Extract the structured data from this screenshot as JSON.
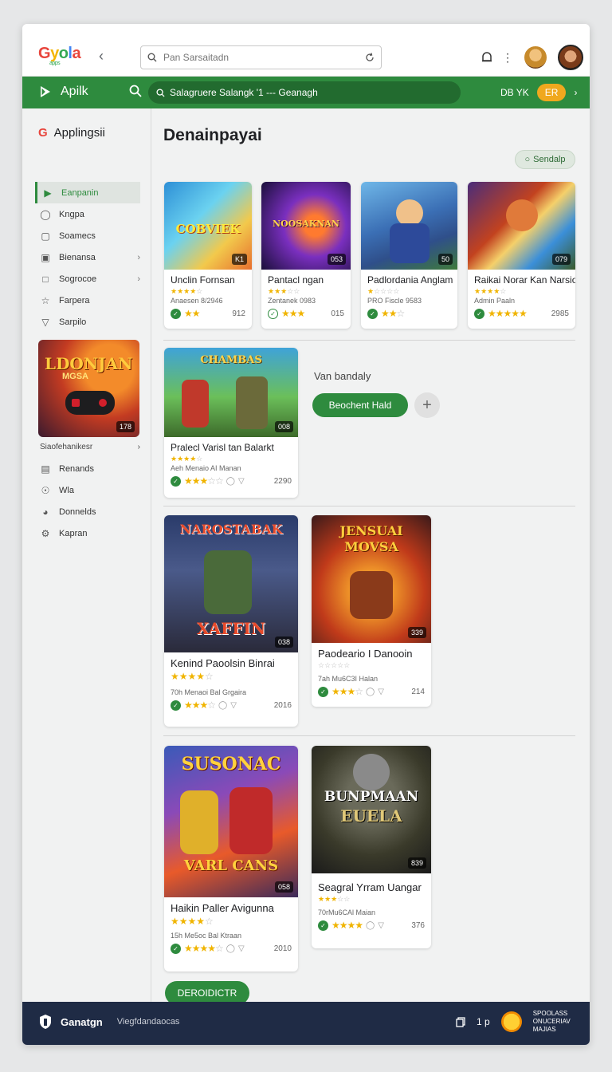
{
  "topbar": {
    "logo": "Gyola",
    "logo_sub": "apps",
    "search_placeholder": "Pan Sarsaitadn"
  },
  "greenbar": {
    "title": "Apilk",
    "search_text": "Salagruere Salangk '1 --- Geanagh",
    "lang": "DB YK",
    "badge": "ER"
  },
  "sidebar": {
    "title": "Applingsii",
    "items": [
      {
        "label": "Eanpanin",
        "icon": "play-icon"
      },
      {
        "label": "Kngpa",
        "icon": "drop-icon"
      },
      {
        "label": "Soamecs",
        "icon": "bag-icon"
      },
      {
        "label": "Bienansa",
        "icon": "book-icon"
      },
      {
        "label": "Sogrocoe",
        "icon": "square-icon"
      },
      {
        "label": "Farpera",
        "icon": "star-icon"
      },
      {
        "label": "Sarpilo",
        "icon": "shield-icon"
      }
    ],
    "promo": {
      "title": "LDONJAN",
      "subtitle": "MGSA",
      "badge": "178"
    },
    "subheading": "Siaofehanikesr",
    "items2": [
      {
        "label": "Renands",
        "icon": "list-icon"
      },
      {
        "label": "Wla",
        "icon": "circle-icon"
      },
      {
        "label": "Donnelds",
        "icon": "download-icon"
      },
      {
        "label": "Kapran",
        "icon": "settings-icon"
      }
    ]
  },
  "main": {
    "title": "Denainpayai",
    "pill": "Sendalp",
    "section_label": "Van bandaly",
    "action_button": "Beochent Hald",
    "load_button": "DEROIDICTR",
    "cards_row1": [
      {
        "art": "COBVIEK",
        "badge": "K1",
        "name": "Unclin Fornsan",
        "sub": "Anaesen 8/2946",
        "num": "912"
      },
      {
        "art": "NOOSAKNAN",
        "badge": "053",
        "name": "Pantacl ngan",
        "sub": "Zentanek 0983",
        "num": "015"
      },
      {
        "art": "",
        "badge": "50",
        "name": "Padlordania Anglam",
        "sub": "PRO Fiscle 9583",
        "num": ""
      },
      {
        "art": "",
        "badge": "079",
        "name": "Raikai Norar Kan Narsio",
        "sub": "Admin Paaln",
        "num": "2985"
      }
    ],
    "featured": {
      "art": "CHAMBAS",
      "badge": "008",
      "name": "Pralecl Varisl tan Balarkt",
      "sub": "Aeh Menaio AI Manan",
      "num": "2290"
    },
    "cards_row2": [
      {
        "art": "NAROSTABAK",
        "art2": "XAFFIN",
        "badge": "038",
        "name": "Kenind Paoolsin Binrai",
        "sub": "70h Menaoi Bal Grgaira",
        "num": "2016"
      },
      {
        "art": "JENSUAI",
        "art2": "MOVSA",
        "badge": "339",
        "name": "Paodeario I Danooin",
        "sub": "7ah Mu6C3I Halan",
        "num": "214"
      }
    ],
    "cards_row3": [
      {
        "art": "SUSONAC",
        "art2": "VARL CANS",
        "badge": "058",
        "name": "Haikin Paller Avigunna",
        "sub": "15h Me5oc Bal Ktraan",
        "num": "2010"
      },
      {
        "art": "BUNPMAAN",
        "art2": "EUELA",
        "badge": "839",
        "name": "Seagral Yrram Uangar",
        "sub": "70rMu6CAl Maian",
        "num": "376"
      }
    ]
  },
  "footer": {
    "brand": "Ganatgn",
    "sub": "Viegfdandaocas",
    "link": "1 p",
    "promo_lines": [
      "SPOOLASS",
      "ONUCERIAV",
      "MAJIAS"
    ]
  }
}
